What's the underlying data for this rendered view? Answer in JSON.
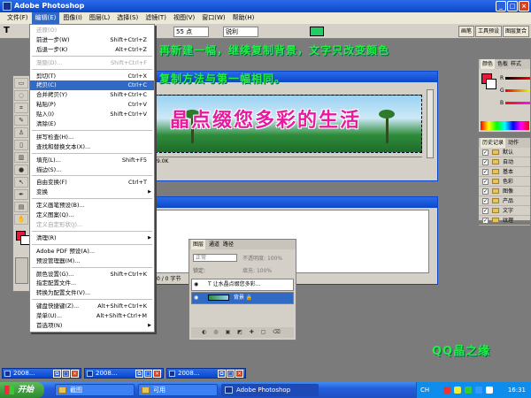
{
  "window": {
    "title": "Adobe Photoshop"
  },
  "menubar": [
    "文件(F)",
    "编辑(E)",
    "图像(I)",
    "图层(L)",
    "选择(S)",
    "滤镜(T)",
    "视图(V)",
    "窗口(W)",
    "帮助(H)"
  ],
  "options": {
    "tool": "T",
    "font_size": "55 点",
    "aa": "锐利",
    "tabs": [
      "画笔",
      "工具预设",
      "图层复合"
    ]
  },
  "edit_menu": [
    {
      "label": "还原(O)",
      "shortcut": "",
      "disabled": true
    },
    {
      "label": "前进一步(W)",
      "shortcut": "Shift+Ctrl+Z"
    },
    {
      "label": "后退一步(K)",
      "shortcut": "Alt+Ctrl+Z"
    },
    {
      "sep": true
    },
    {
      "label": "渐隐(D)...",
      "shortcut": "Shift+Ctrl+F",
      "disabled": true
    },
    {
      "sep": true
    },
    {
      "label": "剪切(T)",
      "shortcut": "Ctrl+X"
    },
    {
      "label": "拷贝(C)",
      "shortcut": "Ctrl+C",
      "highlight": true
    },
    {
      "label": "合并拷贝(Y)",
      "shortcut": "Shift+Ctrl+C"
    },
    {
      "label": "粘贴(P)",
      "shortcut": "Ctrl+V"
    },
    {
      "label": "贴入(I)",
      "shortcut": "Shift+Ctrl+V"
    },
    {
      "label": "清除(E)",
      "shortcut": ""
    },
    {
      "sep": true
    },
    {
      "label": "拼写检查(H)...",
      "shortcut": ""
    },
    {
      "label": "查找和替换文本(X)...",
      "shortcut": ""
    },
    {
      "sep": true
    },
    {
      "label": "填充(L)...",
      "shortcut": "Shift+F5"
    },
    {
      "label": "描边(S)...",
      "shortcut": ""
    },
    {
      "sep": true
    },
    {
      "label": "自由变换(F)",
      "shortcut": "Ctrl+T"
    },
    {
      "label": "变换",
      "shortcut": "",
      "submenu": true
    },
    {
      "sep": true
    },
    {
      "label": "定义画笔预设(B)...",
      "shortcut": ""
    },
    {
      "label": "定义图案(Q)...",
      "shortcut": ""
    },
    {
      "label": "定义自定形状(J)...",
      "shortcut": "",
      "disabled": true
    },
    {
      "sep": true
    },
    {
      "label": "清理(R)",
      "shortcut": "",
      "submenu": true
    },
    {
      "sep": true
    },
    {
      "label": "Adobe PDF 预设(A)...",
      "shortcut": ""
    },
    {
      "label": "预设管理器(M)...",
      "shortcut": ""
    },
    {
      "sep": true
    },
    {
      "label": "颜色设置(G)...",
      "shortcut": "Shift+Ctrl+K"
    },
    {
      "label": "指定配置文件...",
      "shortcut": ""
    },
    {
      "label": "转换为配置文件(V)...",
      "shortcut": ""
    },
    {
      "sep": true
    },
    {
      "label": "键盘快捷键(Z)...",
      "shortcut": "Alt+Shift+Ctrl+K"
    },
    {
      "label": "菜单(U)...",
      "shortcut": "Alt+Shift+Ctrl+M"
    },
    {
      "label": "首选项(N)",
      "shortcut": "",
      "submenu": true
    }
  ],
  "doc1": {
    "title": "/8)",
    "banner": "晶点缀您多彩的生活",
    "status": "9.0K"
  },
  "doc2": {
    "title": "/8)",
    "status": "0 / 0 字节"
  },
  "overlay": {
    "line1": "再新建一幅，继续复制背景，文字只改变颜色",
    "line2": "复制方法与第一幅相同。",
    "signature": "QQ晶之缘"
  },
  "color_palette": {
    "tabs": [
      "颜色",
      "色板",
      "样式"
    ],
    "channels": [
      "R",
      "G",
      "B"
    ],
    "colors": {
      "fg": "#e8173a",
      "bg": "#ffffff"
    }
  },
  "history_palette": {
    "tabs": [
      "历史记录",
      "动作"
    ],
    "rows": [
      "默认",
      "自动",
      "基本",
      "色彩",
      "图像",
      "产品",
      "文字",
      "纹理"
    ]
  },
  "layers_palette": {
    "tabs": [
      "图层",
      "通道",
      "路径"
    ],
    "mode": "正常",
    "opacity": "不透明度:",
    "opacity_value": "100%",
    "lock": "锁定:",
    "fill": "填充:",
    "fill_value": "100%",
    "layers": [
      {
        "name": "让水晶点缀您多彩...",
        "type": "text"
      },
      {
        "name": "背景",
        "type": "image",
        "selected": true
      }
    ]
  },
  "minimized": [
    "2008...",
    "2008...",
    "2008..."
  ],
  "taskbar": {
    "start": "开始",
    "tasks": [
      "截图",
      "可用",
      "Adobe Photoshop"
    ],
    "lang": "CH",
    "clock": "16:31"
  }
}
